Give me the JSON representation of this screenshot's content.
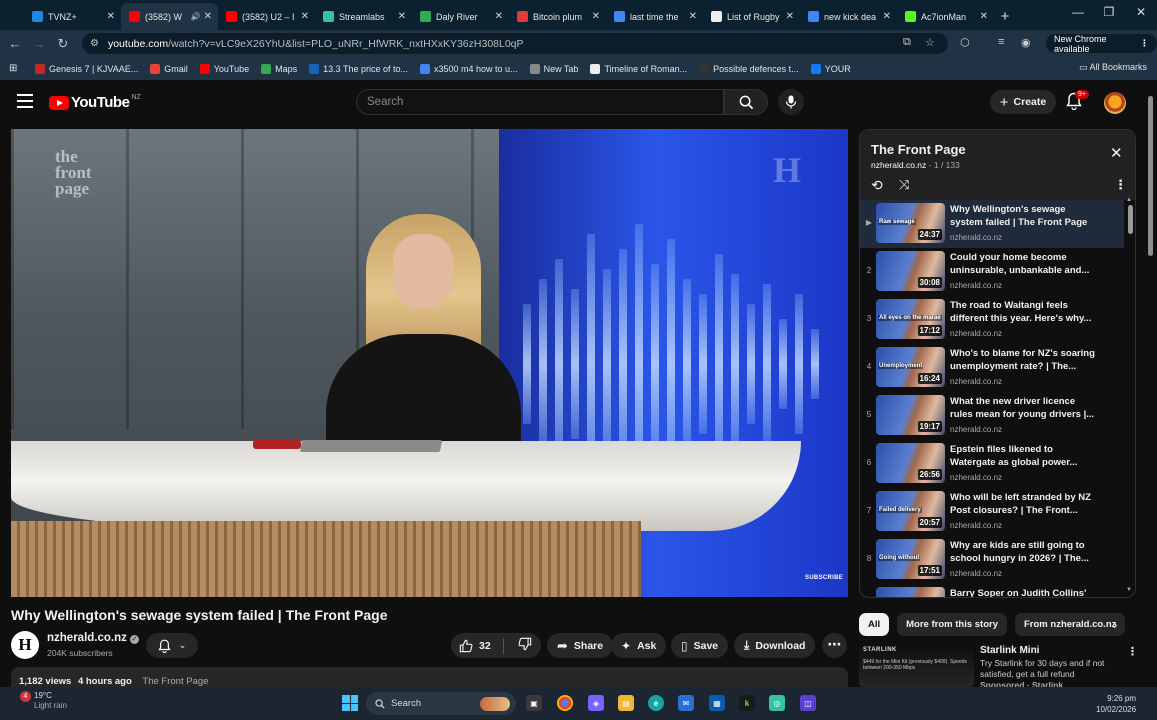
{
  "browser": {
    "tabs": [
      {
        "title": "TVNZ+",
        "icon": "tvnz-icon",
        "color": "#1e88e5"
      },
      {
        "title": "(3582) W",
        "icon": "youtube-icon",
        "color": "#ff0000",
        "active": true,
        "audio": true
      },
      {
        "title": "(3582) U2 – I",
        "icon": "youtube-icon",
        "color": "#ff0000"
      },
      {
        "title": "Streamlabs",
        "icon": "streamlabs-icon",
        "color": "#31c3a2"
      },
      {
        "title": "Daly River",
        "icon": "maps-icon",
        "color": "#34a853"
      },
      {
        "title": "Bitcoin plum",
        "icon": "bitcoin-icon",
        "color": "#e53935"
      },
      {
        "title": "last time the",
        "icon": "google-icon",
        "color": "#4285f4"
      },
      {
        "title": "List of Rugby",
        "icon": "wikipedia-icon",
        "color": "#eeeeee"
      },
      {
        "title": "new kick dea",
        "icon": "google-icon",
        "color": "#4285f4"
      },
      {
        "title": "Ac7ionMan",
        "icon": "kick-icon",
        "color": "#53fc18"
      }
    ],
    "url_host": "youtube.com",
    "url_rest": "/watch?v=vLC9eX26YhU&list=PLO_uNRr_HfWRK_nxtHXxKY36zH308L0qP",
    "new_chrome_label": "New Chrome available",
    "bookmarks": [
      {
        "label": "Genesis 7 | KJVAAE...",
        "color": "#c62828"
      },
      {
        "label": "Gmail",
        "color": "#ea4335"
      },
      {
        "label": "YouTube",
        "color": "#ff0000"
      },
      {
        "label": "Maps",
        "color": "#34a853"
      },
      {
        "label": "13.3 The price of to...",
        "color": "#1565c0"
      },
      {
        "label": "x3500 m4 how to u...",
        "color": "#4285f4"
      },
      {
        "label": "New Tab",
        "color": "#888888"
      },
      {
        "label": "Timeline of Roman...",
        "color": "#eeeeee"
      },
      {
        "label": "Possible defences t...",
        "color": "#333333"
      },
      {
        "label": "YOUR",
        "color": "#1877f2"
      }
    ],
    "all_bookmarks_label": "All Bookmarks"
  },
  "youtube": {
    "logo_text": "YouTube",
    "country_code": "NZ",
    "search_placeholder": "Search",
    "create_label": "Create",
    "notification_badge": "9+"
  },
  "video": {
    "title": "Why Wellington's sewage system failed | The Front Page",
    "watermark_fp": "the front page",
    "watermark_h": "H",
    "subscribe_overlay": "SUBSCRIBE",
    "channel_name": "nzherald.co.nz",
    "channel_initial": "H",
    "subscribers": "204K subscribers",
    "like_count": "32",
    "share_label": "Share",
    "ask_label": "Ask",
    "save_label": "Save",
    "download_label": "Download",
    "views": "1,182 views",
    "age": "4 hours ago",
    "tag": "The Front Page"
  },
  "playlist": {
    "title": "The Front Page",
    "channel": "nzherald.co.nz",
    "position": "1 / 133",
    "items": [
      {
        "index": "▶",
        "title": "Why Wellington's sewage system failed | The Front Page",
        "channel": "nzherald.co.nz",
        "duration": "24:37",
        "caption": "Raw sewage"
      },
      {
        "index": "2",
        "title": "Could your home become uninsurable, unbankable and...",
        "channel": "nzherald.co.nz",
        "duration": "30:08",
        "caption": ""
      },
      {
        "index": "3",
        "title": "The road to Waitangi feels different this year. Here's why...",
        "channel": "nzherald.co.nz",
        "duration": "17:12",
        "caption": "All eyes on the marae"
      },
      {
        "index": "4",
        "title": "Who's to blame for NZ's soaring unemployment rate? | The...",
        "channel": "nzherald.co.nz",
        "duration": "16:24",
        "caption": "Unemployment"
      },
      {
        "index": "5",
        "title": "What the new driver licence rules mean for young drivers |...",
        "channel": "nzherald.co.nz",
        "duration": "19:17",
        "caption": ""
      },
      {
        "index": "6",
        "title": "Epstein files likened to Watergate as global power...",
        "channel": "nzherald.co.nz",
        "duration": "26:56",
        "caption": ""
      },
      {
        "index": "7",
        "title": "Who will be left stranded by NZ Post closures? | The Front...",
        "channel": "nzherald.co.nz",
        "duration": "20:57",
        "caption": "Failed delivery"
      },
      {
        "index": "8",
        "title": "Why are kids are still going to school hungry in 2026? | The...",
        "channel": "nzherald.co.nz",
        "duration": "17:51",
        "caption": "Going without"
      },
      {
        "index": "",
        "title": "Barry Soper on Judith Collins'",
        "channel": "",
        "duration": "",
        "caption": ""
      }
    ]
  },
  "chips": [
    "All",
    "More from this story",
    "From nzherald.co.nz"
  ],
  "ad": {
    "thumb_brand": "STARLINK",
    "thumb_promo": "$449 for the Mini Kit (previously $499). Speeds between 200-350 Mbps",
    "title": "Starlink Mini",
    "description": "Try Starlink for 30 days and if not satisfied, get a full refund",
    "sponsored": "Sponsored · Starlink"
  },
  "taskbar": {
    "weather_badge": "4",
    "temperature": "19°C",
    "condition": "Light rain",
    "search_placeholder": "Search",
    "time": "9:26 pm",
    "date": "10/02/2026"
  }
}
